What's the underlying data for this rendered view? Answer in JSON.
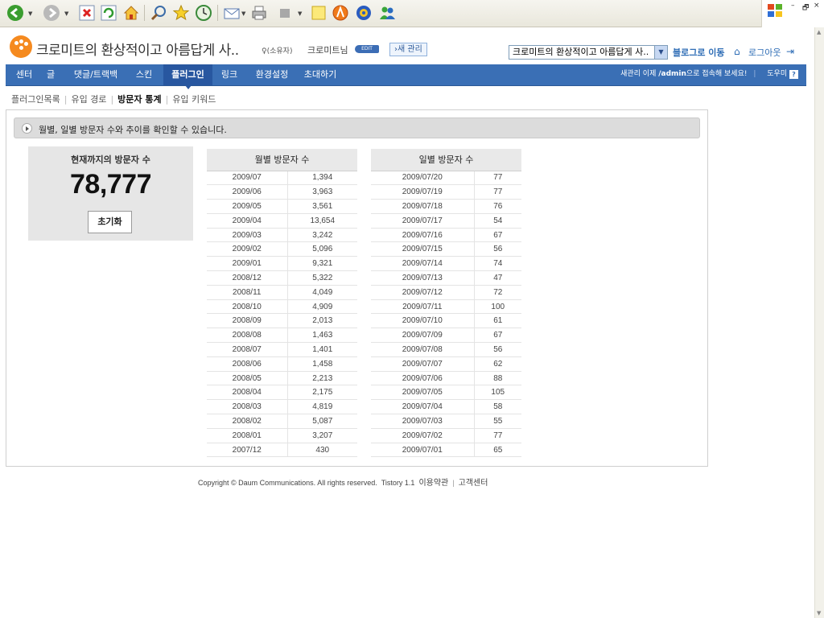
{
  "browser": {
    "buttons": [
      "back-icon",
      "forward-icon",
      "stop-icon",
      "refresh-icon",
      "home-icon",
      "search-icon",
      "favorites-icon",
      "history-icon",
      "mail-icon",
      "print-icon",
      "edit-icon",
      "note-icon",
      "media-icon",
      "settings-icon",
      "messenger-icon"
    ],
    "window_controls": {
      "minimize": "–",
      "restore": "🗗",
      "close": "×"
    }
  },
  "header": {
    "blog_title": "크로미트의 환상적이고 아름답게 사..",
    "owner_label": "♀(소유자)",
    "nickname": "크로미트님",
    "edit_badge": "EDIT",
    "new_manager": "›새 관리",
    "blog_select_value": "크로미트의 환상적이고 아름답게 사..",
    "goto_blog": "블로그로 이동",
    "logout": "로그아웃"
  },
  "nav": {
    "items": [
      {
        "label": "센터"
      },
      {
        "label": "글"
      },
      {
        "label": "댓글/트랙백"
      },
      {
        "label": "스킨"
      },
      {
        "label": "플러그인"
      },
      {
        "label": "링크"
      },
      {
        "label": "환경설정"
      },
      {
        "label": "초대하기"
      }
    ],
    "active_index": 4,
    "right_prefix": "새관리 이제 ",
    "right_url": "/admin",
    "right_suffix": "으로 접속해 보세요!",
    "help_label": "도우미",
    "help_icon": "?"
  },
  "subnav": {
    "items": [
      "플러그인목록",
      "유입 경로",
      "방문자 통계",
      "유입 키워드"
    ],
    "current_index": 2
  },
  "main": {
    "info_text": "월별, 일별 방문자 수와 추이를 확인할 수 있습니다.",
    "visitor_title": "현재까지의 방문자 수",
    "visitor_count": "78,777",
    "reset_label": "초기화",
    "monthly_header": "월별 방문자 수",
    "daily_header": "일별 방문자 수",
    "monthly": [
      [
        "2009/07",
        "1,394"
      ],
      [
        "2009/06",
        "3,963"
      ],
      [
        "2009/05",
        "3,561"
      ],
      [
        "2009/04",
        "13,654"
      ],
      [
        "2009/03",
        "3,242"
      ],
      [
        "2009/02",
        "5,096"
      ],
      [
        "2009/01",
        "9,321"
      ],
      [
        "2008/12",
        "5,322"
      ],
      [
        "2008/11",
        "4,049"
      ],
      [
        "2008/10",
        "4,909"
      ],
      [
        "2008/09",
        "2,013"
      ],
      [
        "2008/08",
        "1,463"
      ],
      [
        "2008/07",
        "1,401"
      ],
      [
        "2008/06",
        "1,458"
      ],
      [
        "2008/05",
        "2,213"
      ],
      [
        "2008/04",
        "2,175"
      ],
      [
        "2008/03",
        "4,819"
      ],
      [
        "2008/02",
        "5,087"
      ],
      [
        "2008/01",
        "3,207"
      ],
      [
        "2007/12",
        "430"
      ]
    ],
    "daily": [
      [
        "2009/07/20",
        "77"
      ],
      [
        "2009/07/19",
        "77"
      ],
      [
        "2009/07/18",
        "76"
      ],
      [
        "2009/07/17",
        "54"
      ],
      [
        "2009/07/16",
        "67"
      ],
      [
        "2009/07/15",
        "56"
      ],
      [
        "2009/07/14",
        "74"
      ],
      [
        "2009/07/13",
        "47"
      ],
      [
        "2009/07/12",
        "72"
      ],
      [
        "2009/07/11",
        "100"
      ],
      [
        "2009/07/10",
        "61"
      ],
      [
        "2009/07/09",
        "67"
      ],
      [
        "2009/07/08",
        "56"
      ],
      [
        "2009/07/07",
        "62"
      ],
      [
        "2009/07/06",
        "88"
      ],
      [
        "2009/07/05",
        "105"
      ],
      [
        "2009/07/04",
        "58"
      ],
      [
        "2009/07/03",
        "55"
      ],
      [
        "2009/07/02",
        "77"
      ],
      [
        "2009/07/01",
        "65"
      ]
    ]
  },
  "footer": {
    "copyright": "Copyright © Daum Communications. All rights reserved.",
    "version": "Tistory 1.1",
    "terms": "이용약관",
    "support": "고객센터"
  },
  "colors": {
    "nav_bg": "#3a6fb5",
    "nav_active": "#2857a0",
    "accent_orange": "#f58a1f",
    "link_blue": "#2d6cb5"
  }
}
